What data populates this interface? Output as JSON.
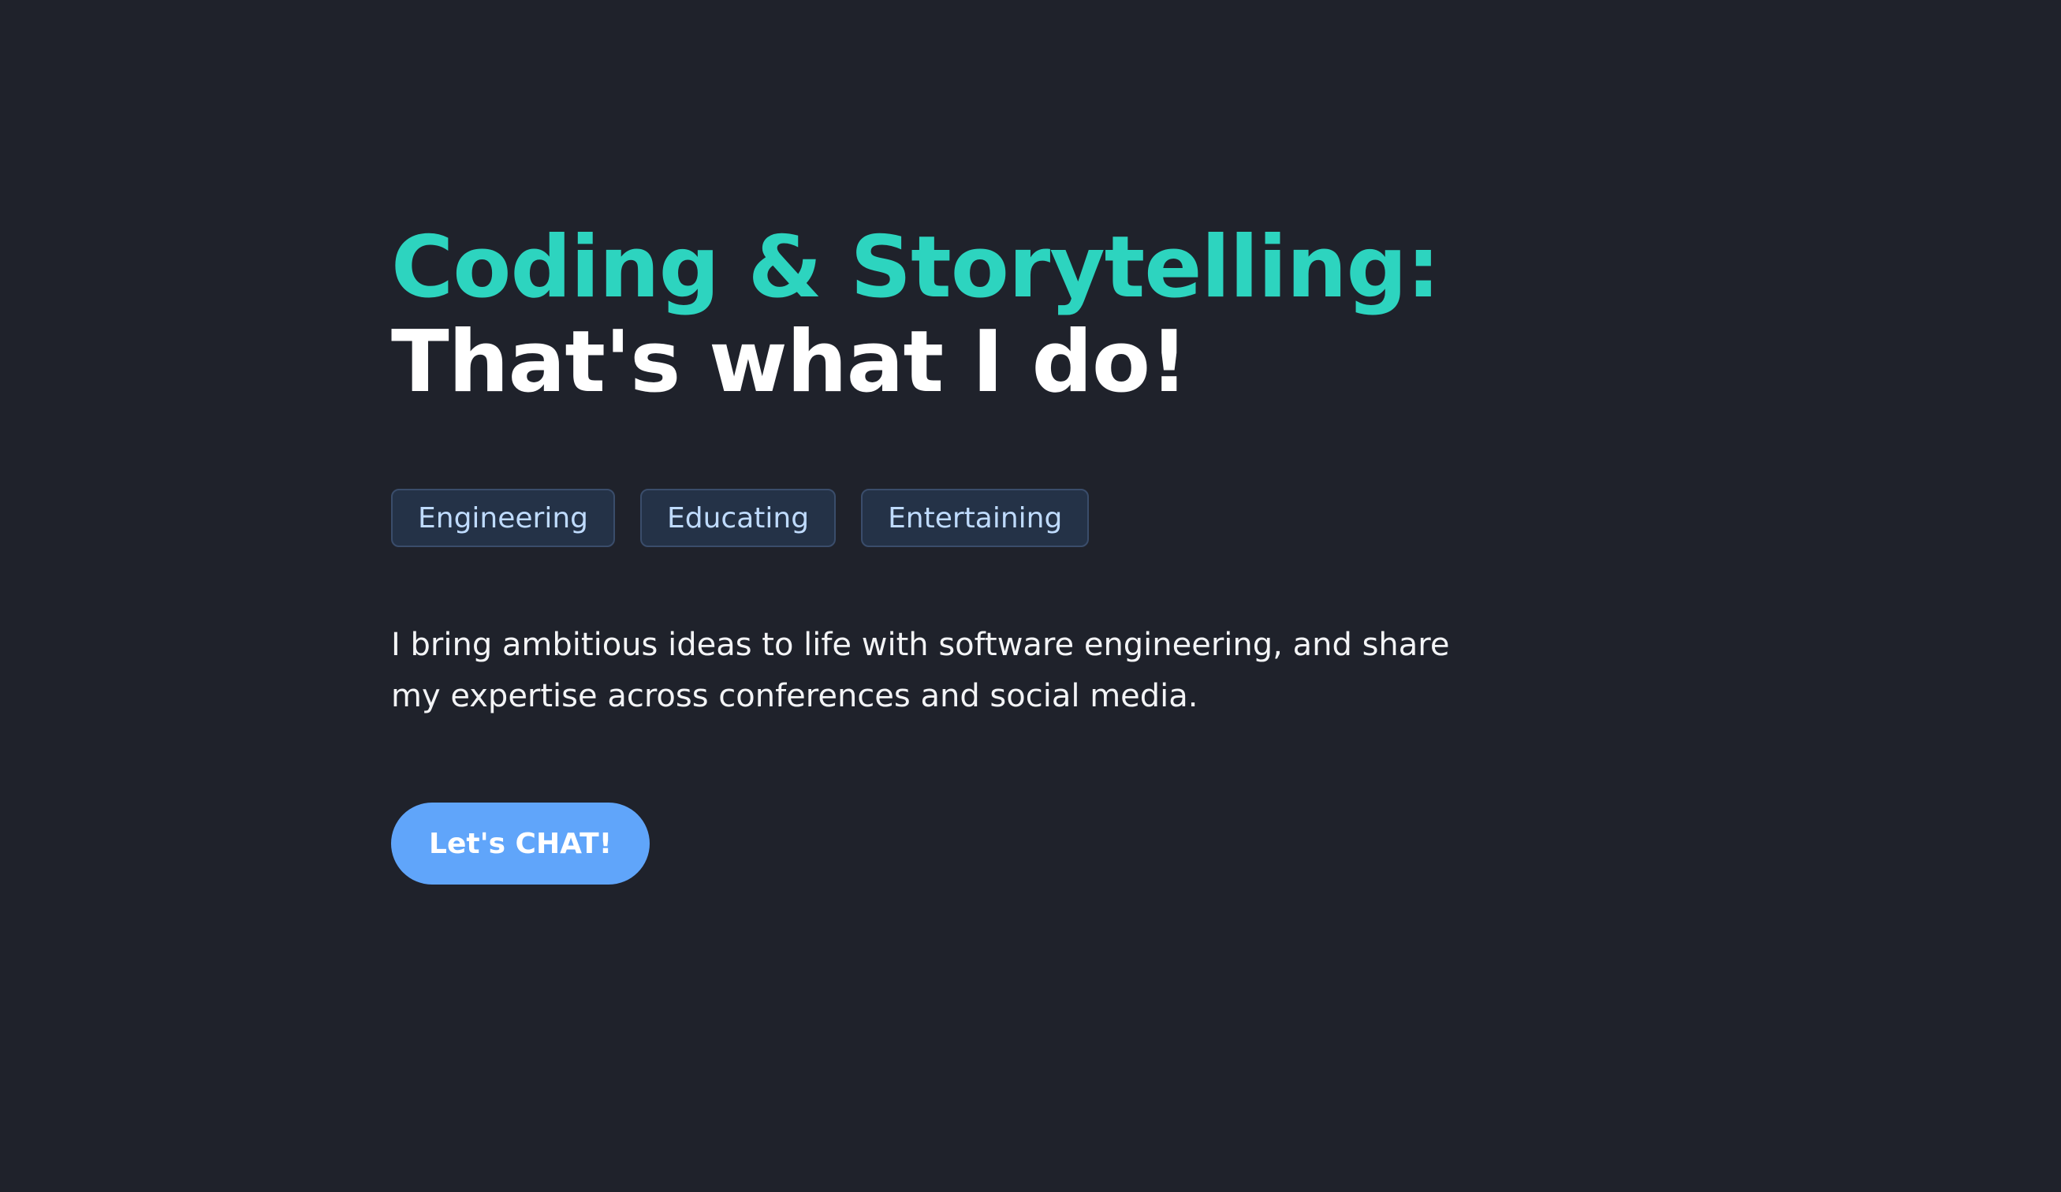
{
  "hero": {
    "headline_accent": "Coding & Storytelling:",
    "headline_main": "That's what I do!",
    "tags": [
      {
        "label": "Engineering"
      },
      {
        "label": "Educating"
      },
      {
        "label": "Entertaining"
      }
    ],
    "description": "I bring ambitious ideas to life with software engineering, and share my expertise across conferences and social media.",
    "cta_label": "Let's CHAT!"
  },
  "colors": {
    "background": "#1f222b",
    "accent": "#2dd4bf",
    "tag_background": "#243247",
    "tag_text": "#bfdbfe",
    "cta_background": "#60a5fa"
  }
}
